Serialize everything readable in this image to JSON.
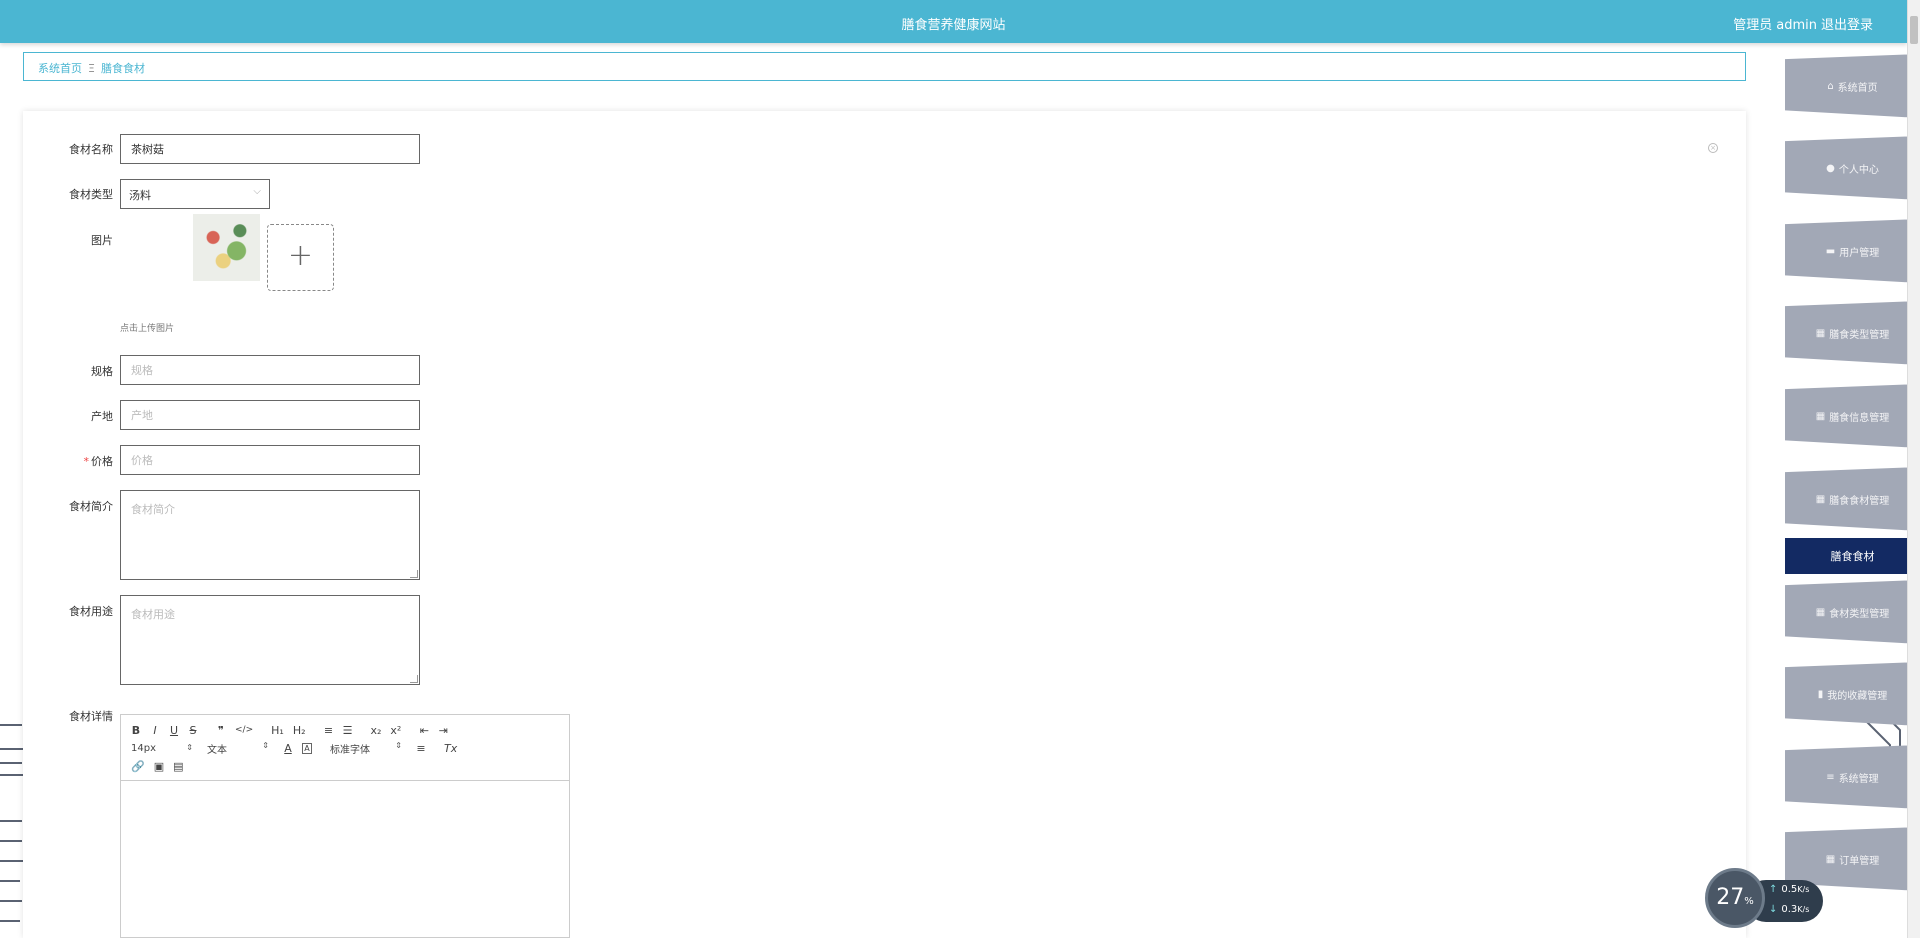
{
  "header": {
    "title": "膳食营养健康网站",
    "role": "管理员",
    "username": "admin",
    "logout": "退出登录"
  },
  "breadcrumb": {
    "home": "系统首页",
    "separator": "Ξ",
    "current": "膳食食材"
  },
  "form": {
    "name_label": "食材名称",
    "name_value": "茶树菇",
    "type_label": "食材类型",
    "type_value": "汤料",
    "image_label": "图片",
    "upload_hint": "点击上传图片",
    "spec_label": "规格",
    "spec_placeholder": "规格",
    "origin_label": "产地",
    "origin_placeholder": "产地",
    "price_required": "*",
    "price_label": "价格",
    "price_placeholder": "价格",
    "intro_label": "食材简介",
    "intro_placeholder": "食材简介",
    "usage_label": "食材用途",
    "usage_placeholder": "食材用途",
    "detail_label": "食材详情"
  },
  "editor": {
    "row1": [
      "B",
      "I",
      "U",
      "S",
      "❞",
      "</>",
      "H₁",
      "H₂",
      "≡",
      "☰",
      "x₂",
      "x²",
      "⇤",
      "⇥"
    ],
    "size": "14px",
    "text": "文本",
    "font": "标准字体",
    "color": "A",
    "bg": "A",
    "align": "≡",
    "clear": "Tx",
    "row3": [
      "🔗",
      "▣",
      "▤"
    ]
  },
  "sidebar": {
    "items": [
      {
        "icon": "⌂",
        "label": "系统首页"
      },
      {
        "icon": "●",
        "label": "个人中心"
      },
      {
        "icon": "▬",
        "label": "用户管理"
      },
      {
        "icon": "▦",
        "label": "膳食类型管理"
      },
      {
        "icon": "▦",
        "label": "膳食信息管理"
      },
      {
        "icon": "▦",
        "label": "膳食食材管理"
      },
      {
        "icon": "",
        "label": "膳食食材"
      },
      {
        "icon": "▦",
        "label": "食材类型管理"
      },
      {
        "icon": "▮",
        "label": "我的收藏管理"
      },
      {
        "icon": "≡",
        "label": "系统管理"
      },
      {
        "icon": "▦",
        "label": "订单管理"
      }
    ]
  },
  "network": {
    "percent": "27",
    "percent_unit": "%",
    "upload": "0.5",
    "download": "0.3",
    "unit": "K/s"
  }
}
